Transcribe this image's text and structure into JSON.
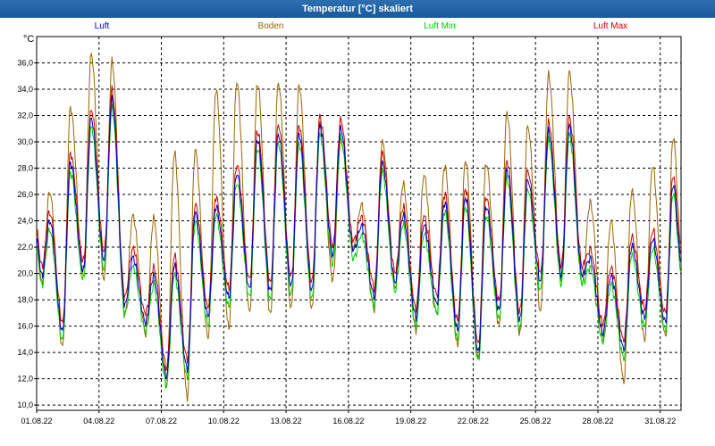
{
  "window": {
    "title": "Temperatur [°C] skaliert"
  },
  "y_unit": "°C",
  "chart_data": {
    "type": "line",
    "title": "Temperatur [°C] skaliert",
    "ylabel": "°C",
    "xlabel": "",
    "ylim": [
      9.6,
      38.0
    ],
    "y_ticks": [
      "10,0",
      "12,0",
      "14,0",
      "16,0",
      "18,0",
      "20,0",
      "22,0",
      "24,0",
      "26,0",
      "28,0",
      "30,0",
      "32,0",
      "34,0",
      "36,0"
    ],
    "x_ticks": [
      "01.08.22",
      "04.08.22",
      "07.08.22",
      "10.08.22",
      "13.08.22",
      "16.08.22",
      "19.08.22",
      "22.08.22",
      "25.08.22",
      "28.08.22",
      "31.08.22"
    ],
    "x_range_days": [
      1,
      32
    ],
    "grid": true,
    "legend_position": "top",
    "colors": {
      "Luft": "#0000cc",
      "Boden": "#996600",
      "Luft Min": "#00cc00",
      "Luft Max": "#cc0000"
    },
    "daily_extremes": {
      "days": [
        "01.08.22",
        "02.08.22",
        "03.08.22",
        "04.08.22",
        "05.08.22",
        "06.08.22",
        "07.08.22",
        "08.08.22",
        "09.08.22",
        "10.08.22",
        "11.08.22",
        "12.08.22",
        "13.08.22",
        "14.08.22",
        "15.08.22",
        "16.08.22",
        "17.08.22",
        "18.08.22",
        "19.08.22",
        "20.08.22",
        "21.08.22",
        "22.08.22",
        "23.08.22",
        "24.08.22",
        "25.08.22",
        "26.08.22",
        "27.08.22",
        "28.08.22",
        "29.08.22",
        "30.08.22",
        "31.08.22"
      ],
      "luft_min": [
        19.8,
        15.6,
        20.2,
        21.0,
        17.6,
        16.3,
        12.2,
        12.8,
        16.8,
        18.2,
        18.8,
        18.6,
        19.0,
        18.7,
        21.4,
        21.8,
        18.3,
        19.4,
        16.7,
        17.7,
        15.7,
        14.0,
        17.2,
        16.4,
        19.4,
        19.9,
        19.9,
        15.5,
        14.3,
        16.7,
        16.3
      ],
      "luft_max": [
        24.0,
        28.4,
        31.8,
        33.2,
        21.2,
        19.8,
        20.6,
        24.6,
        25.1,
        27.6,
        30.2,
        30.6,
        30.6,
        31.2,
        31.0,
        23.6,
        28.4,
        24.4,
        23.7,
        25.4,
        25.8,
        25.1,
        27.9,
        27.1,
        30.8,
        31.2,
        21.1,
        19.8,
        22.1,
        22.6,
        26.8
      ],
      "boden_min": [
        19.2,
        14.4,
        20.0,
        19.5,
        16.8,
        15.4,
        11.5,
        10.6,
        15.1,
        15.8,
        17.0,
        16.8,
        17.3,
        17.3,
        19.5,
        22.0,
        17.3,
        19.0,
        15.7,
        16.9,
        14.5,
        13.5,
        16.0,
        15.3,
        17.1,
        19.6,
        19.2,
        15.0,
        11.8,
        15.0,
        15.2
      ],
      "boden_max": [
        26.2,
        32.6,
        36.7,
        36.1,
        24.4,
        24.2,
        29.2,
        29.4,
        34.0,
        34.6,
        34.5,
        34.5,
        34.3,
        31.4,
        30.1,
        25.2,
        30.0,
        26.8,
        27.5,
        28.2,
        28.6,
        28.4,
        32.2,
        31.2,
        35.1,
        35.3,
        25.4,
        24.0,
        26.3,
        28.2,
        30.4
      ]
    },
    "series": [
      {
        "name": "Luft",
        "key": "luft"
      },
      {
        "name": "Boden",
        "key": "boden"
      },
      {
        "name": "Luft Min",
        "key": "luftmin"
      },
      {
        "name": "Luft Max",
        "key": "luftmax"
      }
    ]
  }
}
